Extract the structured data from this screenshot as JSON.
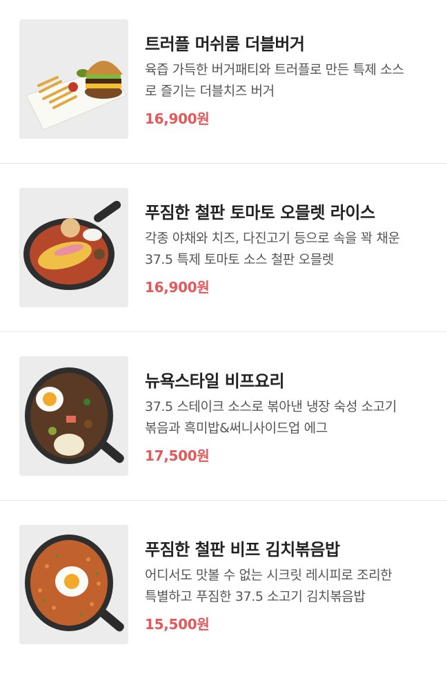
{
  "menu": [
    {
      "title": "트러플 머쉬룸 더블버거",
      "desc_line1": "육즙 가득한 버거패티와 트러플로 만든 특제 소스",
      "desc_line2": "로 즐기는 더블치즈 버거",
      "price": "16,900원",
      "image_icon": "burger-plate-icon"
    },
    {
      "title": "푸짐한 철판 토마토 오믈렛 라이스",
      "desc_line1": "각종 야채와 치즈, 다진고기 등으로 속을 꽉 채운",
      "desc_line2": "37.5 특제 토마토 소스 철판 오믈렛",
      "price": "16,900원",
      "image_icon": "omelet-skillet-icon"
    },
    {
      "title": "뉴욕스타일 비프요리",
      "desc_line1": "37.5 스테이크 소스로 볶아낸 냉장 숙성 소고기",
      "desc_line2": "볶음과 흑미밥&써니사이드업 에그",
      "price": "17,500원",
      "image_icon": "beef-skillet-icon"
    },
    {
      "title": "푸짐한 철판 비프 김치볶음밥",
      "desc_line1": "어디서도 맛볼 수 없는 시크릿 레시피로 조리한",
      "desc_line2": "특별하고 푸짐한 37.5 소고기 김치볶음밥",
      "price": "15,500원",
      "image_icon": "kimchi-fried-rice-skillet-icon"
    }
  ],
  "colors": {
    "price": "#e5585a",
    "title": "#222222",
    "desc": "#555555",
    "divider": "#e6e6e6"
  }
}
